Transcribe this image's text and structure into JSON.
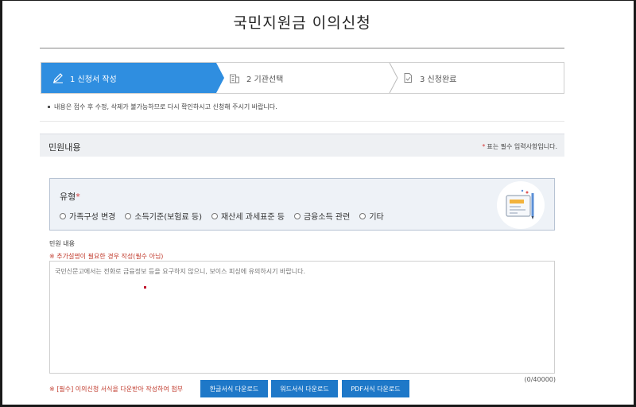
{
  "page": {
    "title": "국민지원금 이의신청"
  },
  "steps": [
    {
      "label": "1 신청서 작성",
      "icon": "pencil-icon",
      "active": true
    },
    {
      "label": "2 기관선택",
      "icon": "building-icon",
      "active": false
    },
    {
      "label": "3 신청완료",
      "icon": "document-check-icon",
      "active": false
    }
  ],
  "notice": "내용은 접수 후 수정, 삭제가 불가능하므로 다시 확인하시고 신청해 주시기 바랍니다.",
  "section": {
    "title": "민원내용",
    "required_star": "*",
    "required_note": "표는 필수 입력사항입니다."
  },
  "type_field": {
    "label": "유형",
    "star": "*",
    "options": [
      "가족구성 변경",
      "소득기준(보험료 등)",
      "재산세 과세표준 등",
      "금융소득 관련",
      "기타"
    ],
    "illustration": "form-document-illustration"
  },
  "content_field": {
    "label": "민원 내용",
    "note": "※ 추가설명이 필요한 경우 작성(필수 아님)",
    "placeholder": "국민신문고에서는 전화로 금융정보 등을 요구하지 않으니, 보이스 피싱에 유의하시기 바랍니다.",
    "count": "(0/40000)"
  },
  "downloads": {
    "note": "※ [필수] 이의신청 서식을 다운받아 작성하여 첨부",
    "buttons": [
      "한글서식 다운로드",
      "워드서식 다운로드",
      "PDF서식 다운로드"
    ]
  },
  "colors": {
    "accent": "#2f8ee0",
    "button": "#1e78c8",
    "required": "#d43c3c",
    "note_red": "#c0392b"
  }
}
